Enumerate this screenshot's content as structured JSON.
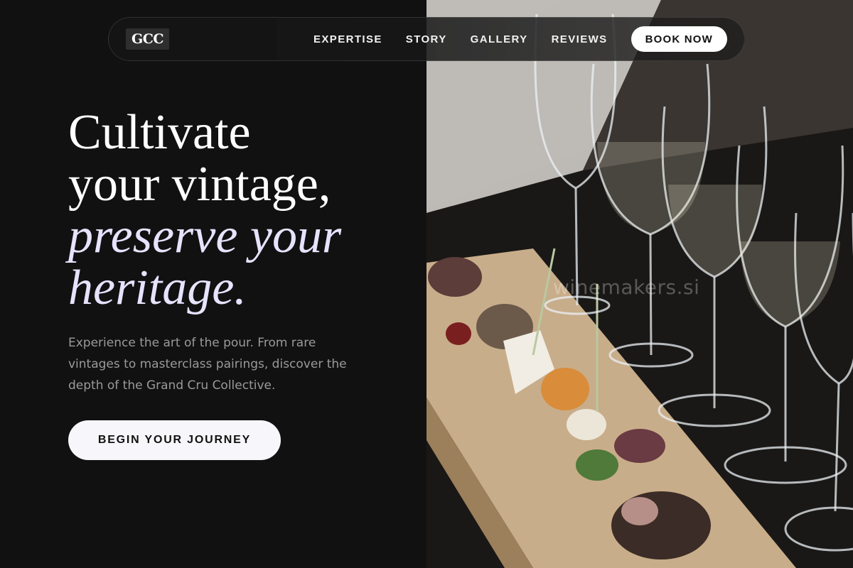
{
  "nav": {
    "logo": "GCC",
    "links": [
      "EXPERTISE",
      "STORY",
      "GALLERY",
      "REVIEWS"
    ],
    "cta": "BOOK NOW"
  },
  "hero": {
    "headline_line1": "Cultivate",
    "headline_line2": "your vintage,",
    "headline_line3": "preserve your",
    "headline_line4": "heritage.",
    "subtext": "Experience the art of the pour. From rare vintages to masterclass pairings, discover the depth of the Grand Cru Collective.",
    "cta": "BEGIN YOUR JOURNEY"
  },
  "photo": {
    "watermark": "winemakers.si"
  },
  "colors": {
    "background": "#111111",
    "accent_text": "#e6e3ff",
    "button_bg": "#ffffff"
  }
}
